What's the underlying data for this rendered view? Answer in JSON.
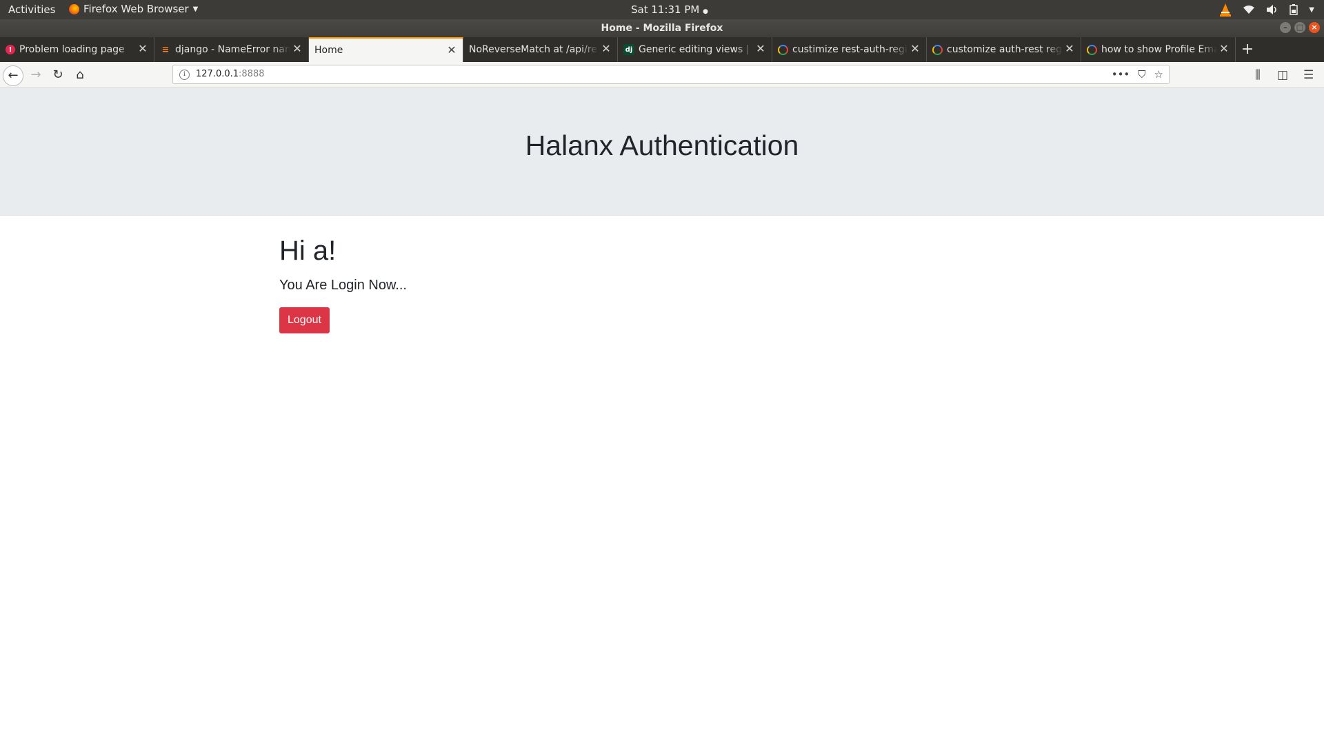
{
  "system_bar": {
    "activities": "Activities",
    "app_name": "Firefox Web Browser",
    "clock": "Sat 11:31 PM"
  },
  "window": {
    "title": "Home - Mozilla Firefox"
  },
  "tabs": [
    {
      "label": "Problem loading page",
      "favicon": "error-icon",
      "active": false
    },
    {
      "label": "django - NameError name",
      "favicon": "stackoverflow-icon",
      "active": false
    },
    {
      "label": "Home",
      "favicon": "",
      "active": true
    },
    {
      "label": "NoReverseMatch at /api/re",
      "favicon": "",
      "active": false
    },
    {
      "label": "Generic editing views | Dj",
      "favicon": "django-icon",
      "active": false
    },
    {
      "label": "custimize rest-auth-regis",
      "favicon": "google-icon",
      "active": false
    },
    {
      "label": "customize auth-rest regi",
      "favicon": "google-icon",
      "active": false
    },
    {
      "label": "how to show Profile Ema",
      "favicon": "google-icon",
      "active": false
    }
  ],
  "address_bar": {
    "host": "127.0.0.1",
    "port": ":8888"
  },
  "page": {
    "jumbotron_title": "Halanx Authentication",
    "greeting": "Hi a!",
    "status_text": "You Are Login Now...",
    "logout_label": "Logout"
  },
  "colors": {
    "jumbotron_bg": "#e9ecef",
    "logout_button": "#dc3545",
    "topbar_bg": "#3c3b37",
    "active_tab_accent": "#ff9400"
  }
}
